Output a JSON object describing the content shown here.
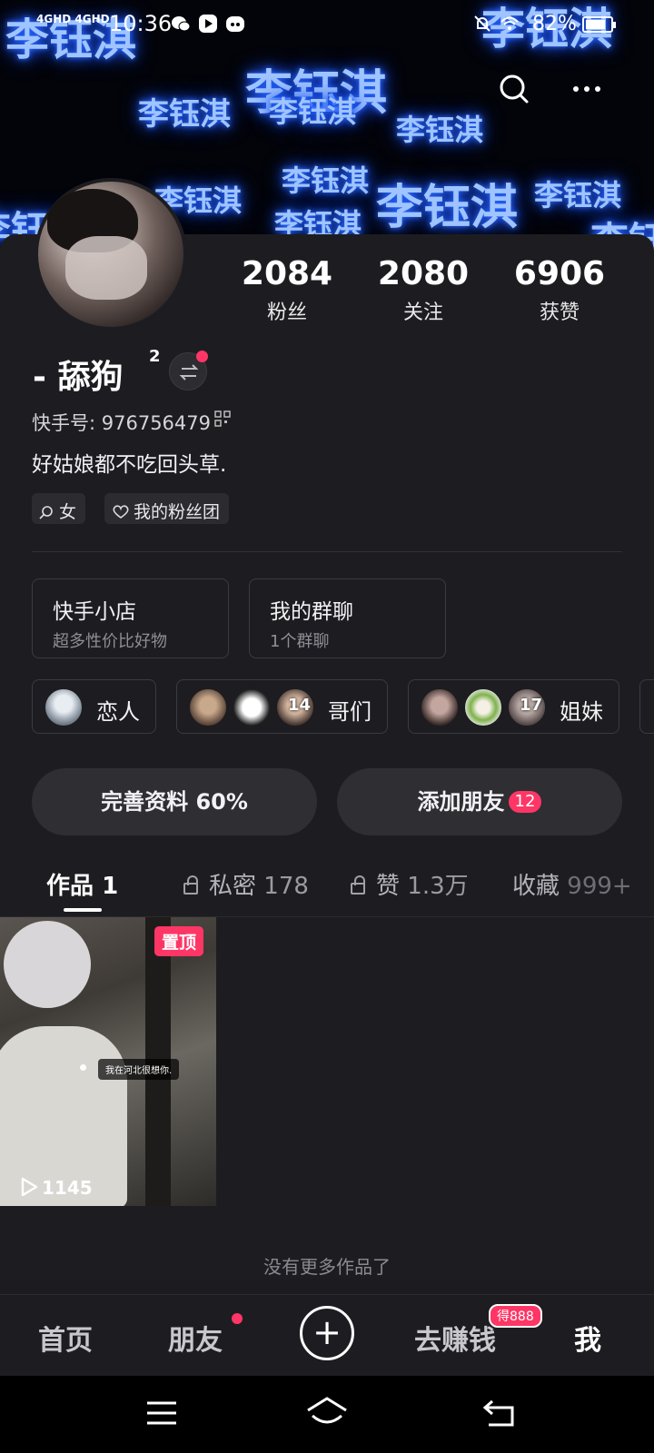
{
  "status_bar": {
    "network": "4GHD 4GHD",
    "time": "10:36",
    "battery_percent": "82%",
    "battery_level": 0.82
  },
  "header": {
    "background_text": "李钰淇",
    "icons": [
      "search-icon",
      "more-icon"
    ]
  },
  "profile": {
    "stats": [
      {
        "value": "2084",
        "label": "粉丝"
      },
      {
        "value": "2080",
        "label": "关注"
      },
      {
        "value": "6906",
        "label": "获赞"
      }
    ],
    "name": "- 舔狗",
    "name_superscript": "2",
    "kuaishou_id": "快手号: 976756479",
    "bio": "好姑娘都不吃回头草.",
    "tags": [
      {
        "icon": "search-icon",
        "label": "女"
      },
      {
        "icon": "heart-icon",
        "label": "我的粉丝团"
      }
    ]
  },
  "cards": [
    {
      "title": "快手小店",
      "subtitle": "超多性价比好物"
    },
    {
      "title": "我的群聊",
      "subtitle": "1个群聊"
    }
  ],
  "groups": [
    {
      "label": "恋人",
      "count": ""
    },
    {
      "label": "哥们",
      "count": "14"
    },
    {
      "label": "姐妹",
      "count": "17"
    }
  ],
  "actions": {
    "complete_profile": "完善资料 60%",
    "add_friends": "添加朋友",
    "add_friends_badge": "12"
  },
  "tabs": [
    {
      "label": "作品",
      "count": "1"
    },
    {
      "label": "私密",
      "count": "178"
    },
    {
      "label": "赞",
      "count": "1.3万"
    },
    {
      "label": "收藏",
      "count": "999+"
    }
  ],
  "works": [
    {
      "pinned_label": "置顶",
      "caption": "我在河北很想你.",
      "plays": "1145"
    }
  ],
  "no_more": "没有更多作品了",
  "bottom_nav": {
    "home": "首页",
    "friends": "朋友",
    "earn": "去赚钱",
    "earn_badge": "得888",
    "me": "我"
  },
  "colors": {
    "accent": "#fe3666",
    "background": "#1d1d21",
    "glow": "#2a6bff"
  }
}
